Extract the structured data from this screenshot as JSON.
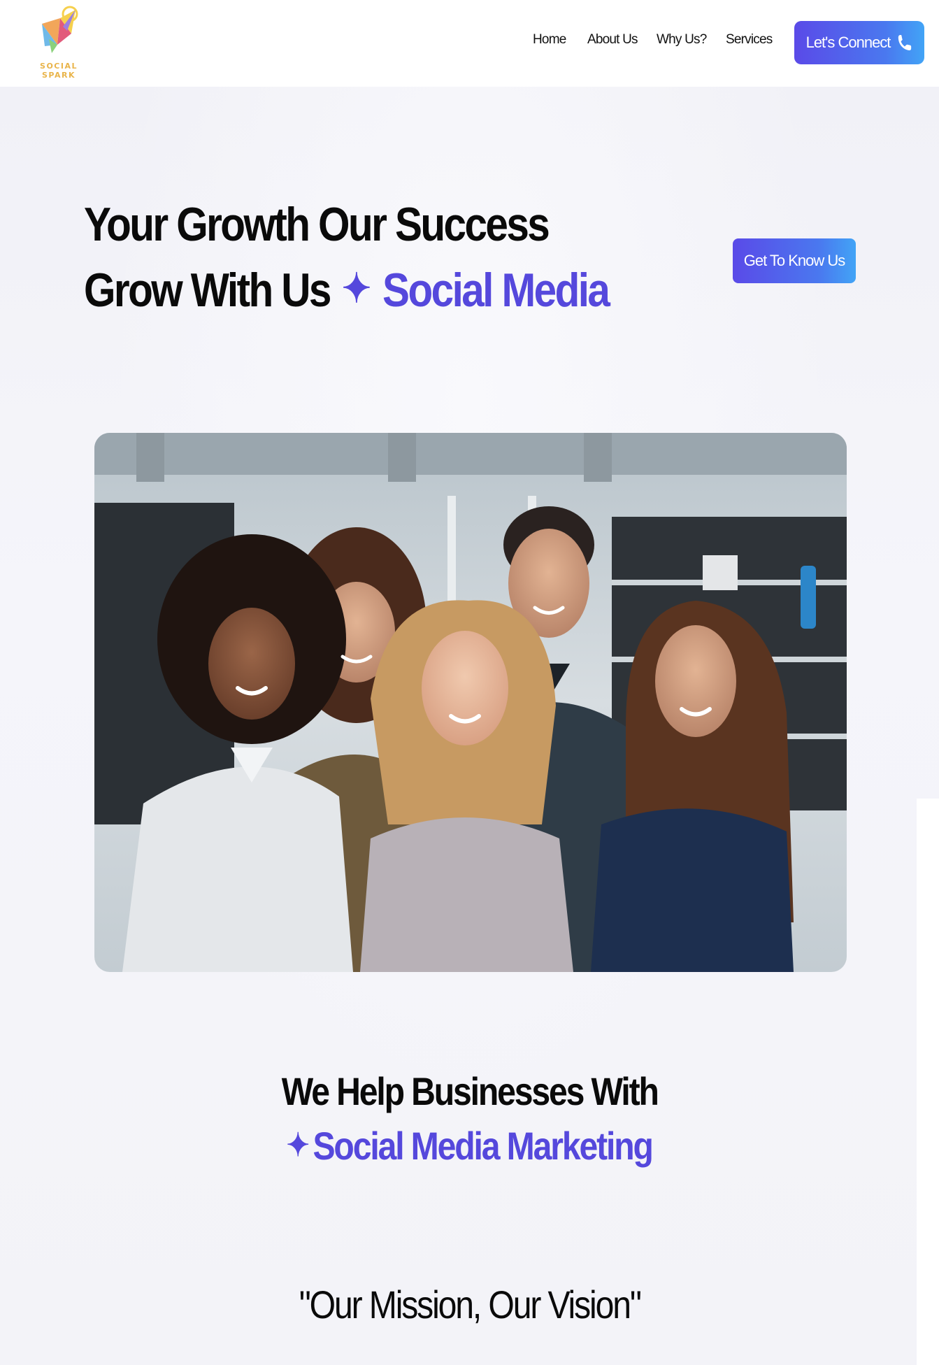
{
  "brand": {
    "name": "SOCIAL SPARK",
    "logo_icon": "paper-plane-spark-logo"
  },
  "nav": {
    "items": [
      {
        "label": "Home"
      },
      {
        "label": "About Us"
      },
      {
        "label": "Why Us?"
      },
      {
        "label": "Services"
      }
    ],
    "cta_label": "Let's Connect",
    "cta_icon": "phone-icon"
  },
  "hero": {
    "line1": "Your Growth Our Success",
    "line2_plain": "Grow With Us",
    "sparkle": "✦",
    "line2_accent": "Social Media",
    "button_label": "Get To Know Us",
    "image_subject": "team-photo"
  },
  "help": {
    "title": "We Help Businesses With",
    "sparkle": "✦",
    "subtitle": "Social Media Marketing"
  },
  "mission": {
    "title": "\"Our Mission, Our Vision\""
  },
  "colors": {
    "accent": "#5548dc",
    "button_gradient_start": "#5a4ae8",
    "button_gradient_end": "#42a4f6",
    "logo_text": "#e9b44a",
    "page_bg": "#f3f3f8"
  }
}
